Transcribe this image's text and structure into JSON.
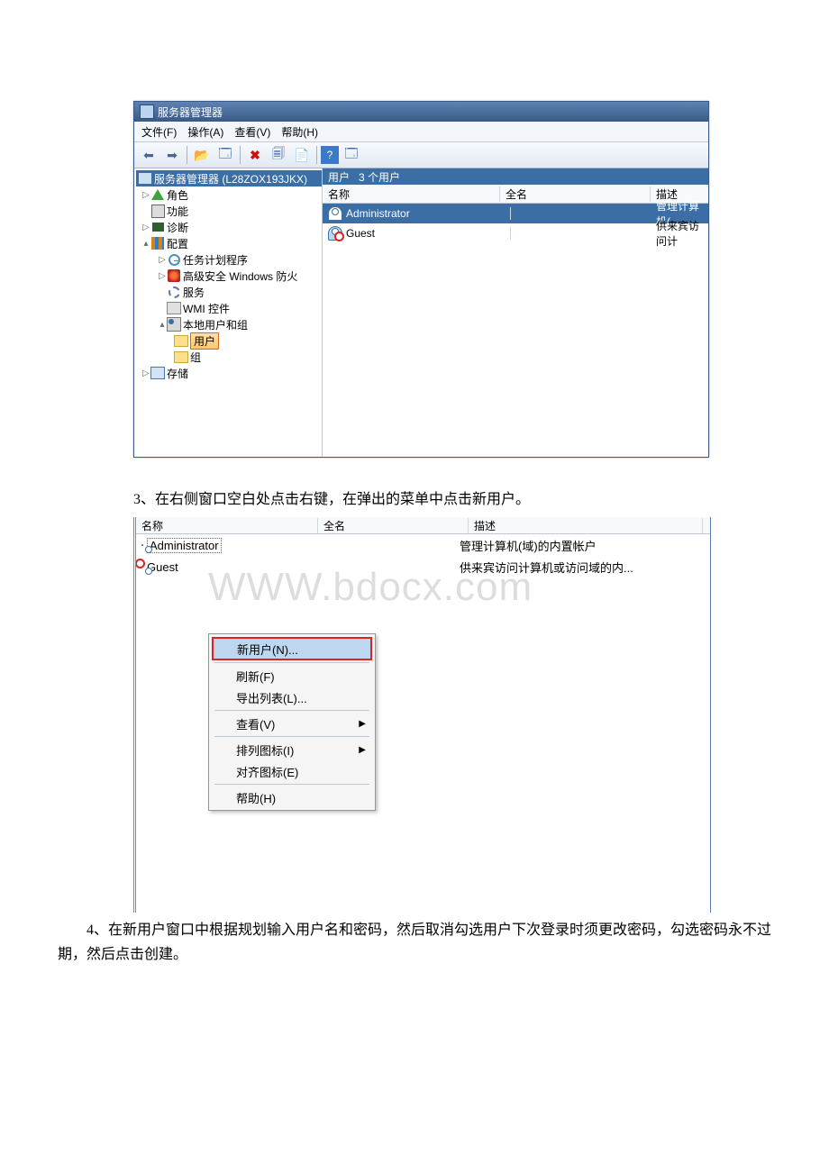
{
  "sm": {
    "title": "服务器管理器",
    "menu": {
      "file": "文件(F)",
      "action": "操作(A)",
      "view": "查看(V)",
      "help": "帮助(H)"
    },
    "tree": {
      "root": "服务器管理器 (L28ZOX193JKX)",
      "roles": "角色",
      "features": "功能",
      "diag": "诊断",
      "conf": "配置",
      "task": "任务计划程序",
      "fw": "高级安全 Windows 防火",
      "svc": "服务",
      "wmi": "WMI 控件",
      "lug": "本地用户和组",
      "users": "用户",
      "groups": "组",
      "storage": "存储"
    },
    "list": {
      "header_title": "用户",
      "header_count": "3 个用户",
      "col_name": "名称",
      "col_full": "全名",
      "col_desc": "描述",
      "rows": [
        {
          "name": "Administrator",
          "desc": "管理计算机("
        },
        {
          "name": "Guest",
          "desc": "供来宾访问计"
        }
      ]
    }
  },
  "step3": "3、在右侧窗口空白处点击右键，在弹出的菜单中点击新用户。",
  "s2": {
    "col_name": "名称",
    "col_full": "全名",
    "col_desc": "描述",
    "rows": [
      {
        "name": "Administrator",
        "desc": "管理计算机(域)的内置帐户"
      },
      {
        "name": "Guest",
        "desc": "供来宾访问计算机或访问域的内..."
      }
    ],
    "watermark": "WWW.bdocx.com",
    "ctx": {
      "new_user": "新用户(N)...",
      "refresh": "刷新(F)",
      "export": "导出列表(L)...",
      "view": "查看(V)",
      "arrange": "排列图标(I)",
      "align": "对齐图标(E)",
      "help": "帮助(H)"
    }
  },
  "step4": "4、在新用户窗口中根据规划输入用户名和密码，然后取消勾选用户下次登录时须更改密码，勾选密码永不过期，然后点击创建。"
}
